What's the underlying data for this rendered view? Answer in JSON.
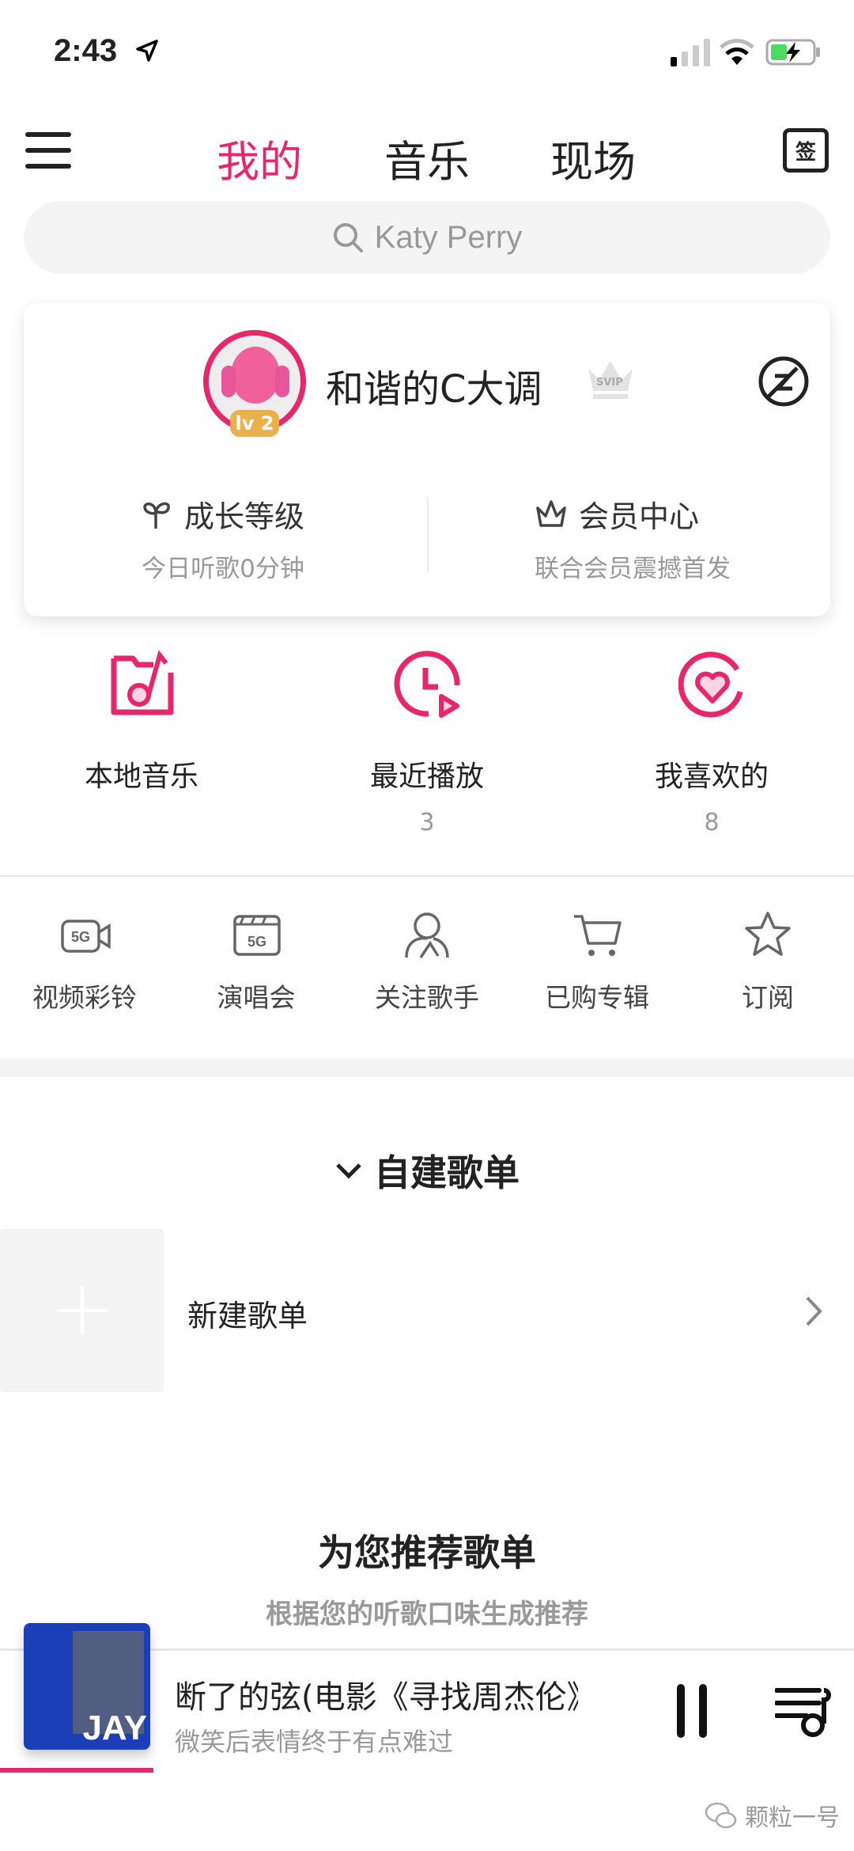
{
  "status_bar": {
    "time": "2:43"
  },
  "header": {
    "tabs": [
      {
        "label": "我的",
        "active": true
      },
      {
        "label": "音乐",
        "active": false
      },
      {
        "label": "现场",
        "active": false
      }
    ],
    "checkin_label": "签"
  },
  "search": {
    "placeholder": "Katy Perry"
  },
  "profile": {
    "username": "和谐的C大调",
    "level": "lv 2",
    "badge": "SVIP",
    "stats": [
      {
        "title": "成长等级",
        "subtitle": "今日听歌0分钟",
        "icon": "sprout-icon"
      },
      {
        "title": "会员中心",
        "subtitle": "联合会员震撼首发",
        "icon": "crown-icon"
      }
    ]
  },
  "features": [
    {
      "label": "本地音乐",
      "count": ""
    },
    {
      "label": "最近播放",
      "count": "3"
    },
    {
      "label": "我喜欢的",
      "count": "8"
    }
  ],
  "shortcuts": [
    {
      "label": "视频彩铃",
      "icon": "video-5g-icon"
    },
    {
      "label": "演唱会",
      "icon": "concert-5g-icon"
    },
    {
      "label": "关注歌手",
      "icon": "singer-icon"
    },
    {
      "label": "已购专辑",
      "icon": "cart-icon"
    },
    {
      "label": "订阅",
      "icon": "star-icon"
    }
  ],
  "my_playlists": {
    "title": "自建歌单",
    "new_label": "新建歌单"
  },
  "recommend": {
    "title": "为您推荐歌单",
    "subtitle": "根据您的听歌口味生成推荐"
  },
  "player": {
    "title": "断了的弦(电影《寻找周杰伦》插曲)",
    "subtitle": "微笑后表情终于有点难过",
    "art_text": "JAY",
    "progress": 0.18
  },
  "watermark": "颗粒一号",
  "colors": {
    "accent": "#e8266b"
  }
}
